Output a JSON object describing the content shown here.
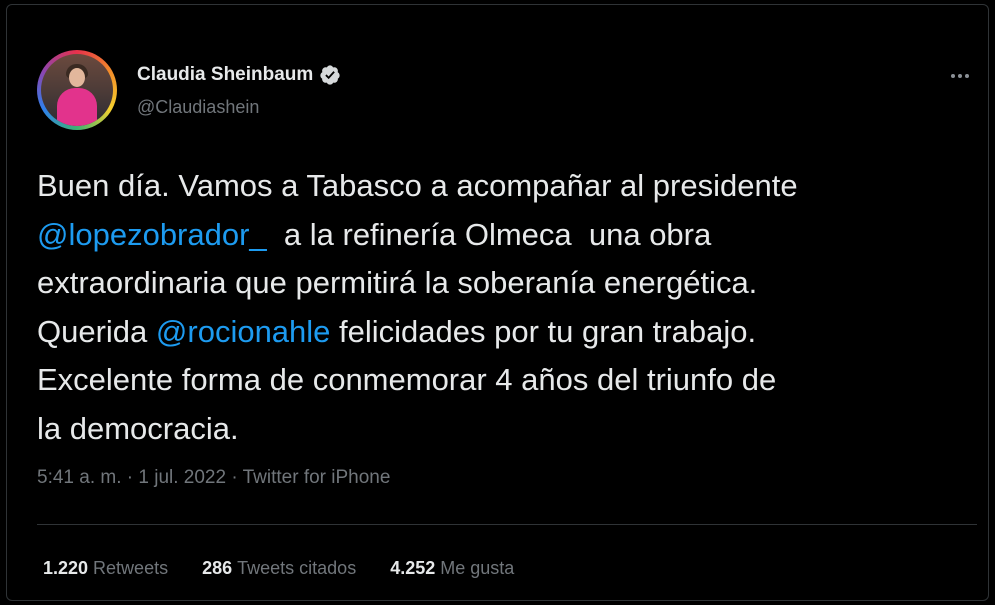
{
  "author": {
    "name": "Claudia Sheinbaum",
    "handle": "@Claudiashein",
    "verified_icon": "verified-badge-icon"
  },
  "tweet": {
    "line1": "Buen día. Vamos a Tabasco a acompañar al presidente",
    "mention1": "@lopezobrador_",
    "line2_rest": "  a la refinería Olmeca  una obra",
    "line3": "extraordinaria que permitirá la soberanía energética.",
    "line4_start": "Querida ",
    "mention2": "@rocionahle",
    "line4_rest": " felicidades por tu gran trabajo.",
    "line5": "Excelente forma de conmemorar 4 años del triunfo de",
    "line6": "la democracia."
  },
  "meta": "5:41 a. m. · 1 jul. 2022 · Twitter for iPhone",
  "stats": {
    "retweets_count": "1.220",
    "retweets_label": "Retweets",
    "quotes_count": "286",
    "quotes_label": "Tweets citados",
    "likes_count": "4.252",
    "likes_label": "Me gusta"
  },
  "colors": {
    "background": "#000000",
    "text": "#e7e9ea",
    "secondary": "#71767b",
    "link": "#1d9bf0",
    "divider": "#2f3336"
  }
}
